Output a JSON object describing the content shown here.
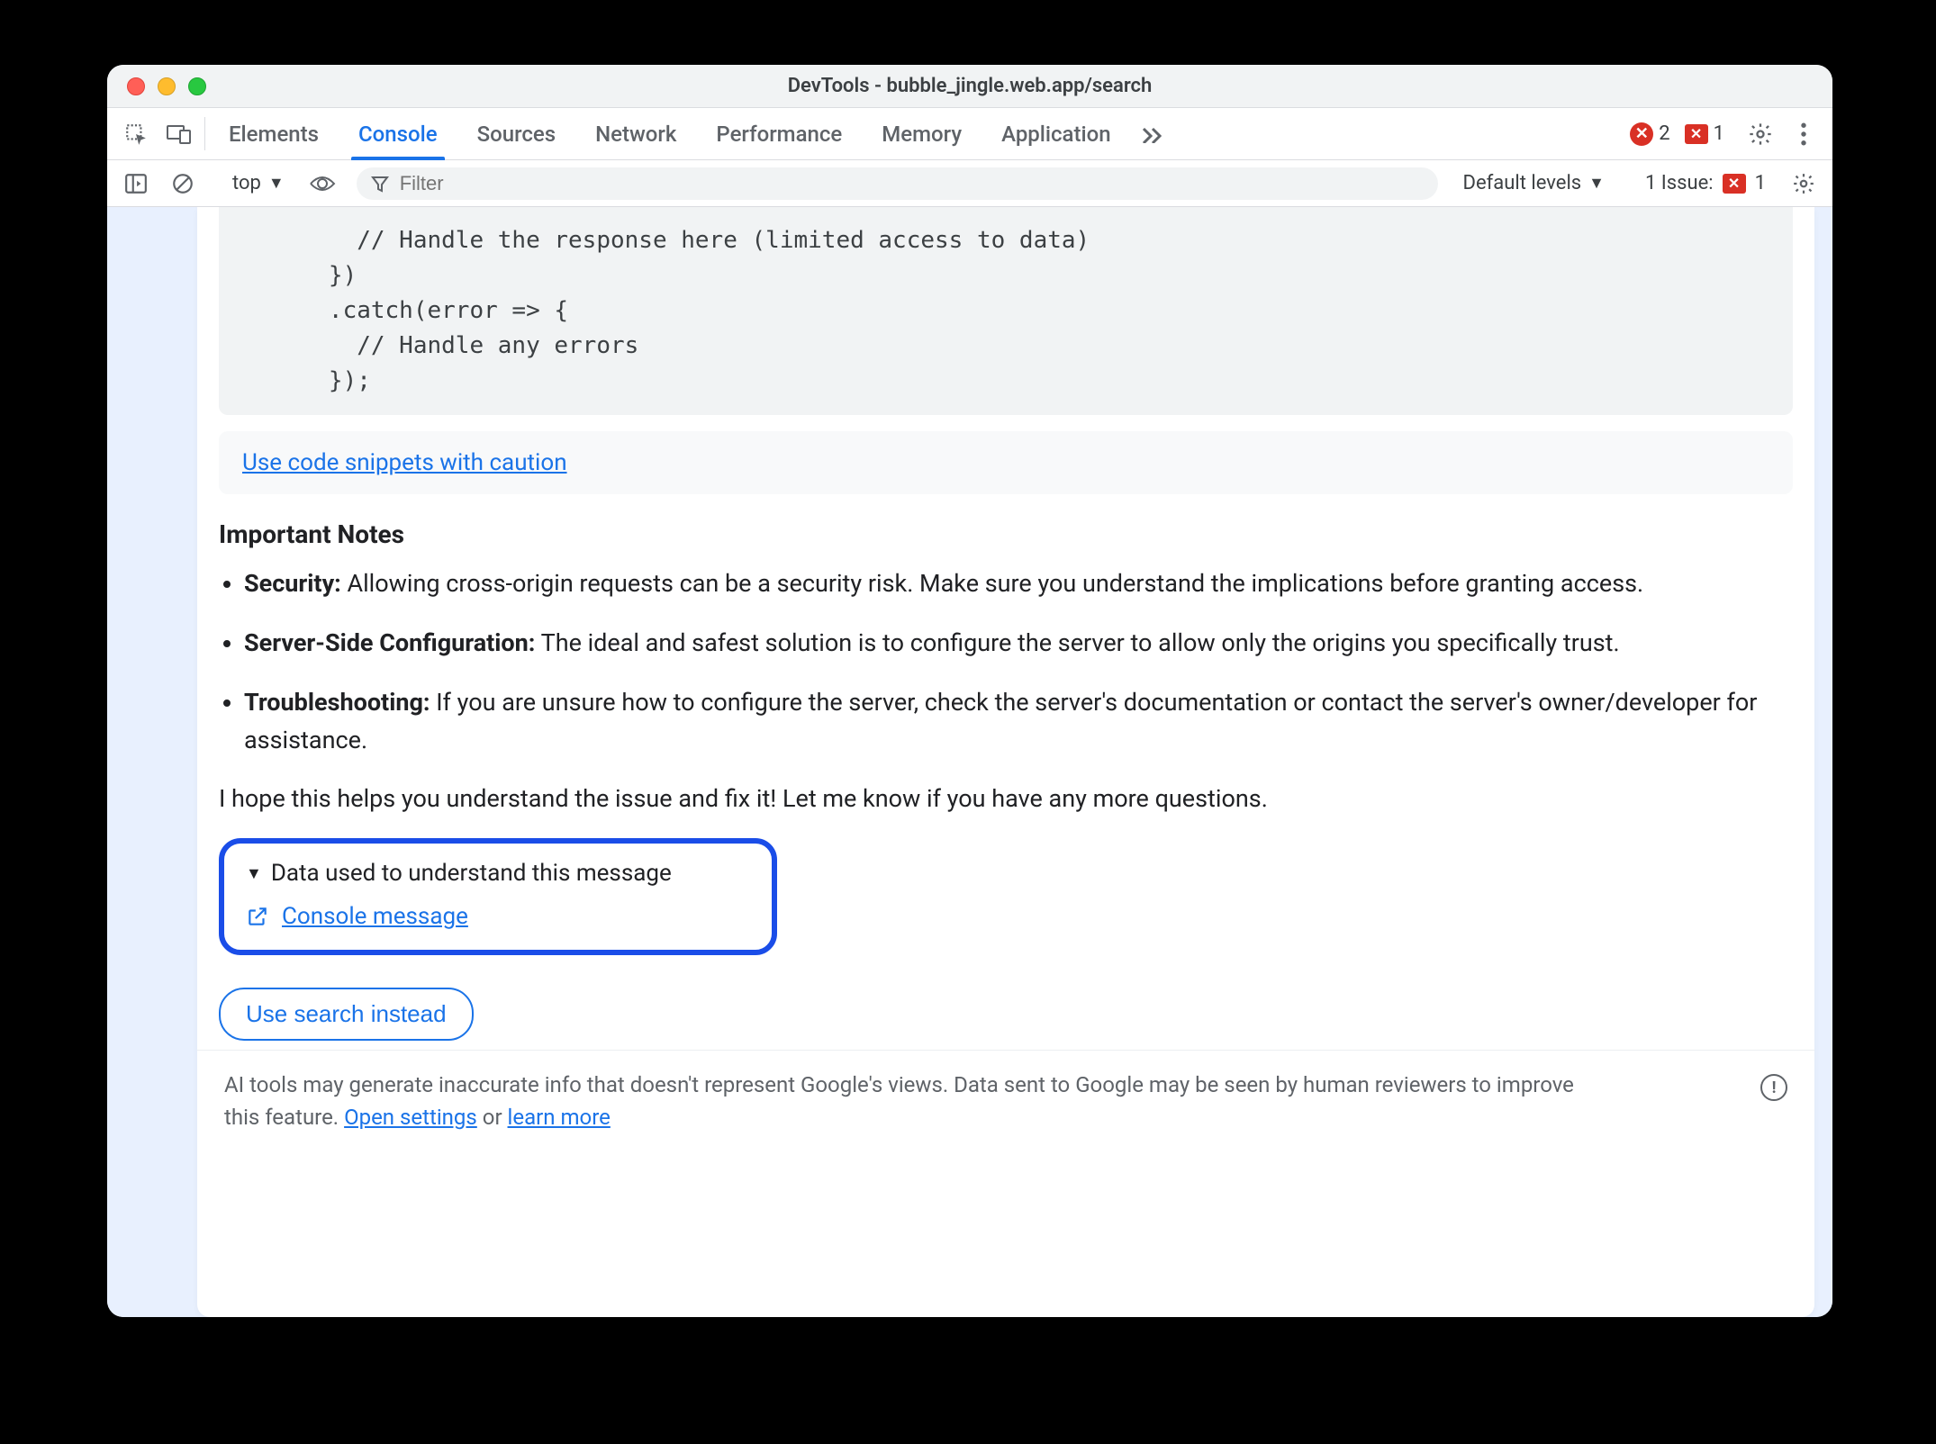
{
  "window": {
    "title": "DevTools - bubble_jingle.web.app/search"
  },
  "tabs": {
    "items": [
      "Elements",
      "Console",
      "Sources",
      "Network",
      "Performance",
      "Memory",
      "Application"
    ],
    "active": "Console"
  },
  "counters": {
    "errors": "2",
    "flags": "1"
  },
  "subbar": {
    "context": "top",
    "filter_placeholder": "Filter",
    "levels": "Default levels",
    "issue_label": "1 Issue:",
    "issue_count": "1"
  },
  "code": "        // Handle the response here (limited access to data)\n      })\n      .catch(error => {\n        // Handle any errors\n      });",
  "caution_link": "Use code snippets with caution",
  "section_heading": "Important Notes",
  "notes": [
    {
      "b": "Security:",
      "t": " Allowing cross-origin requests can be a security risk. Make sure you understand the implications before granting access."
    },
    {
      "b": "Server-Side Configuration:",
      "t": " The ideal and safest solution is to configure the server to allow only the origins you specifically trust."
    },
    {
      "b": "Troubleshooting:",
      "t": " If you are unsure how to configure the server, check the server's documentation or contact the server's owner/developer for assistance."
    }
  ],
  "closing": "I hope this helps you understand the issue and fix it! Let me know if you have any more questions.",
  "disclosure": {
    "summary": "Data used to understand this message",
    "link": "Console message"
  },
  "pill_button": "Use search instead",
  "footer": {
    "text_a": "AI tools may generate inaccurate info that doesn't represent Google's views. Data sent to Google may be seen by human reviewers to improve this feature. ",
    "link1": "Open settings",
    "mid": " or ",
    "link2": "learn more"
  }
}
